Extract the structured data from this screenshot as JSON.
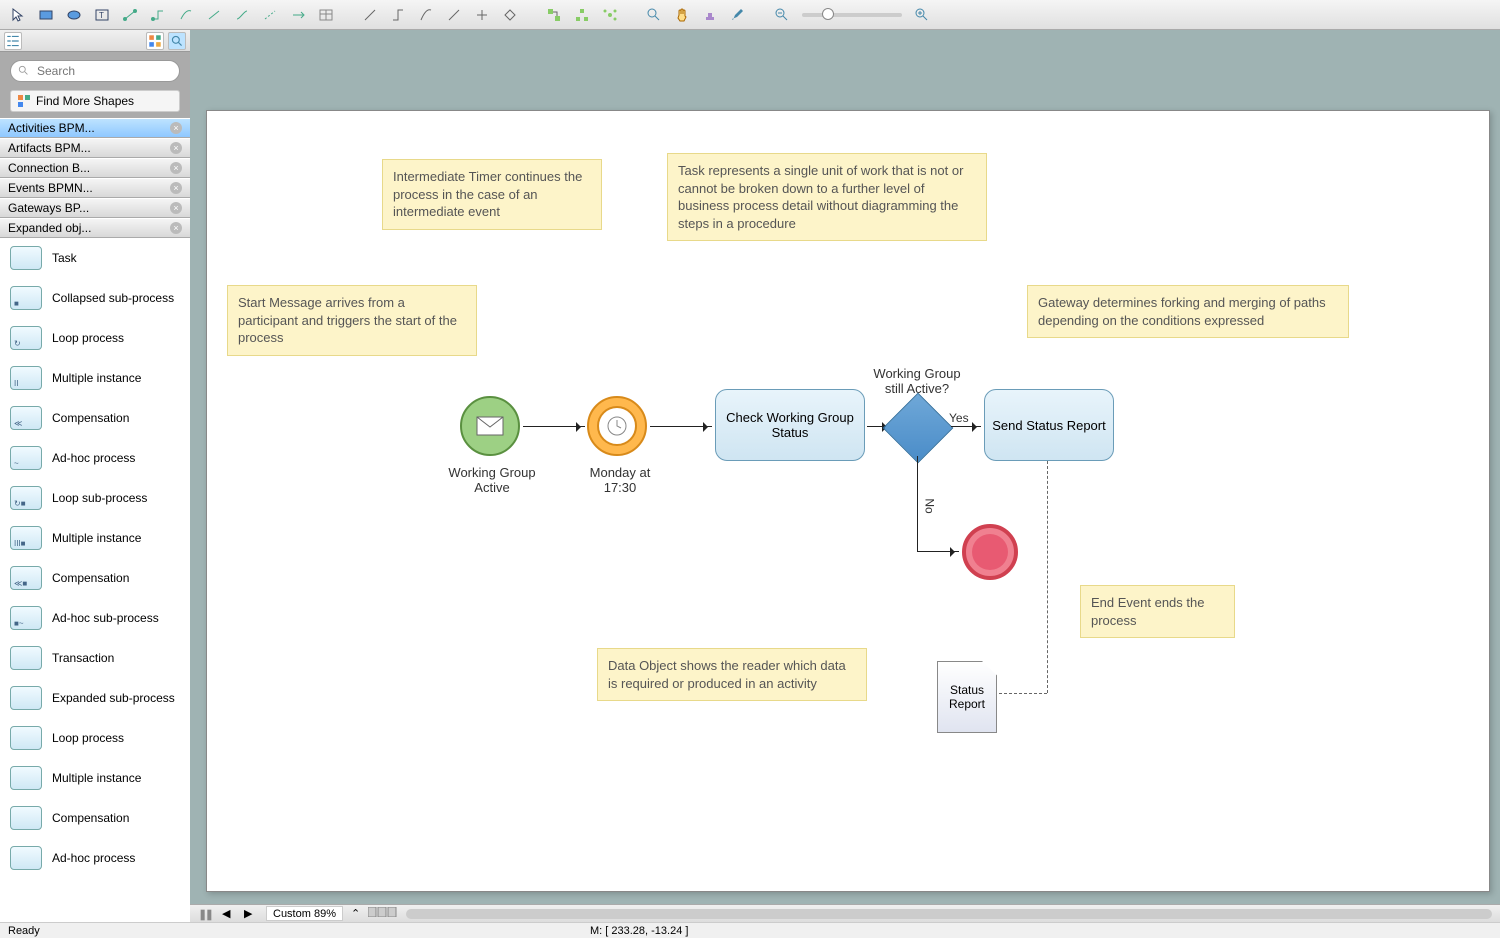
{
  "search": {
    "placeholder": "Search"
  },
  "find_more": "Find More Shapes",
  "categories": [
    {
      "label": "Activities BPM...",
      "selected": true
    },
    {
      "label": "Artifacts BPM..."
    },
    {
      "label": "Connection B..."
    },
    {
      "label": "Events BPMN..."
    },
    {
      "label": "Gateways BP..."
    },
    {
      "label": "Expanded obj..."
    }
  ],
  "shapes": [
    {
      "label": "Task",
      "sub": ""
    },
    {
      "label": "Collapsed sub-process",
      "sub": "■"
    },
    {
      "label": "Loop process",
      "sub": "↻"
    },
    {
      "label": "Multiple instance",
      "sub": "II"
    },
    {
      "label": "Compensation",
      "sub": "≪"
    },
    {
      "label": "Ad-hoc process",
      "sub": "~"
    },
    {
      "label": "Loop sub-process",
      "sub": "↻■"
    },
    {
      "label": "Multiple instance",
      "sub": "III■"
    },
    {
      "label": "Compensation",
      "sub": "≪■"
    },
    {
      "label": "Ad-hoc sub-process",
      "sub": "■~"
    },
    {
      "label": "Transaction",
      "sub": ""
    },
    {
      "label": "Expanded sub-process",
      "sub": ""
    },
    {
      "label": "Loop process",
      "sub": ""
    },
    {
      "label": "Multiple instance",
      "sub": ""
    },
    {
      "label": "Compensation",
      "sub": ""
    },
    {
      "label": "Ad-hoc process",
      "sub": ""
    }
  ],
  "diagram": {
    "start_label": "Working Group Active",
    "timer_label": "Monday at 17:30",
    "task1": "Check Working Group Status",
    "task2": "Send Status Report",
    "gateway_q": "Working Group still Active?",
    "yes": "Yes",
    "no": "No",
    "dataobj": "Status Report",
    "annot_start": "Start Message arrives from a participant and triggers the start of the process",
    "annot_timer": "Intermediate Timer continues the process in the case of an intermediate event",
    "annot_task": "Task represents a single unit of work that is not or cannot be broken down to a further level of business process detail without diagramming the steps in a procedure",
    "annot_gateway": "Gateway determines forking and merging of paths depending on the conditions expressed",
    "annot_end": "End Event ends the process",
    "annot_data": "Data Object shows the reader which data is required or produced in an activity"
  },
  "bottom": {
    "zoom": "Custom 89%"
  },
  "status": {
    "ready": "Ready",
    "coord": "M: [ 233.28, -13.24 ]"
  }
}
